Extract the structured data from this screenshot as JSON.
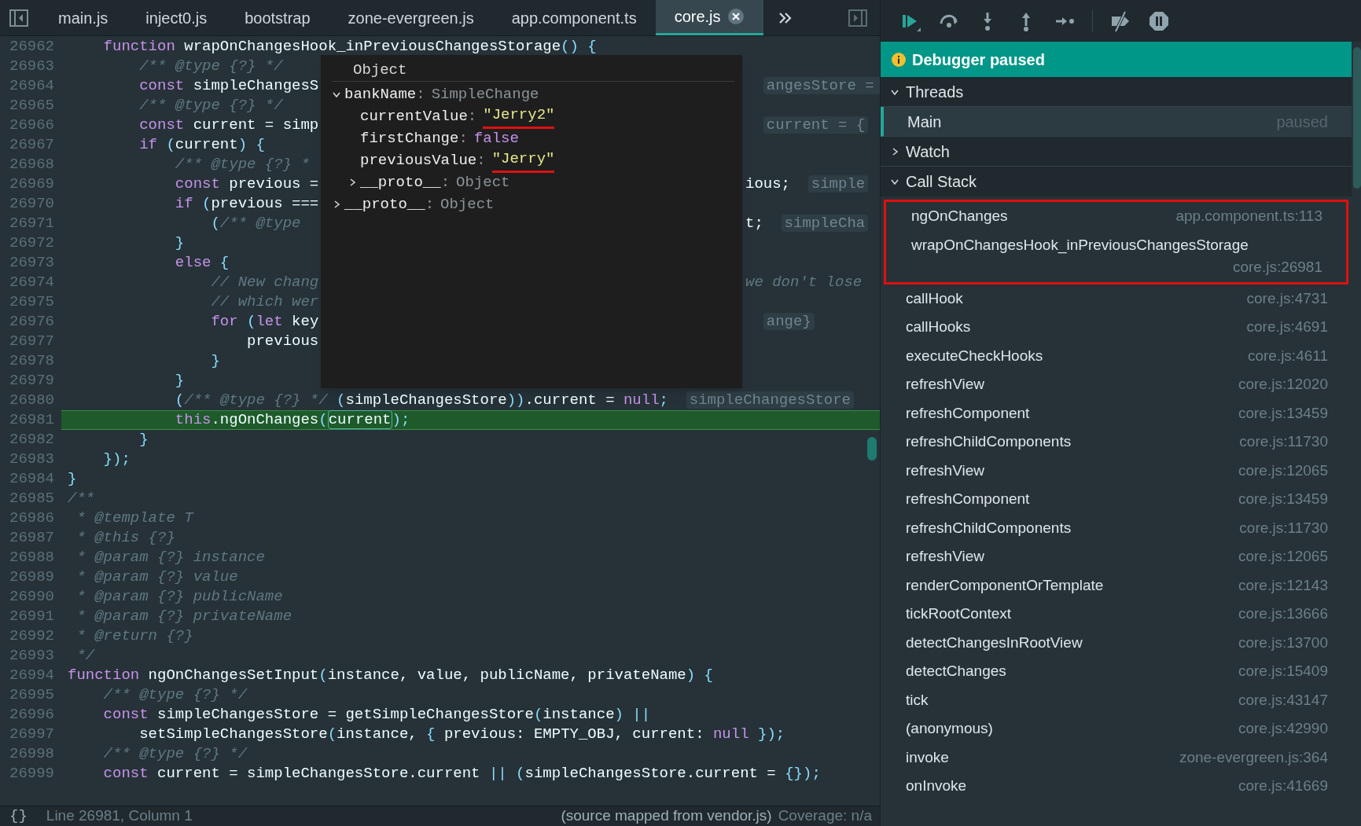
{
  "tabs": [
    {
      "label": "main.js",
      "selected": false
    },
    {
      "label": "inject0.js",
      "selected": false
    },
    {
      "label": "bootstrap",
      "selected": false
    },
    {
      "label": "zone-evergreen.js",
      "selected": false
    },
    {
      "label": "app.component.ts",
      "selected": false
    },
    {
      "label": "core.js",
      "selected": true
    }
  ],
  "editor": {
    "lines": [
      {
        "num": "26962",
        "highlighted": false,
        "code": [
          {
            "t": "    function",
            "kind": "kw"
          },
          {
            "t": " wrapOnChangesHook_inPreviousChangesStorage",
            "kind": "id"
          },
          {
            "t": "() {",
            "kind": "pn"
          }
        ]
      },
      {
        "num": "26963",
        "highlighted": false,
        "code": [
          {
            "t": "        /** @type {?} */",
            "kind": "cm"
          }
        ]
      },
      {
        "num": "26964",
        "highlighted": false,
        "code": [
          {
            "t": "        const",
            "kind": "kw"
          },
          {
            "t": " simpleChangesS",
            "kind": "id"
          }
        ],
        "after": [
          {
            "t": "angesStore = ",
            "kind": "hint"
          }
        ]
      },
      {
        "num": "26965",
        "highlighted": false,
        "code": [
          {
            "t": "        /** @type {?} */",
            "kind": "cm"
          }
        ]
      },
      {
        "num": "26966",
        "highlighted": false,
        "code": [
          {
            "t": "        const",
            "kind": "kw"
          },
          {
            "t": " current = simp",
            "kind": "id"
          }
        ],
        "after": [
          {
            "t": "current = {",
            "kind": "hint"
          }
        ]
      },
      {
        "num": "26967",
        "highlighted": false,
        "code": [
          {
            "t": "        if",
            "kind": "kw"
          },
          {
            "t": " (",
            "kind": "pn"
          },
          {
            "t": "current",
            "kind": "id"
          },
          {
            "t": ") {",
            "kind": "pn"
          }
        ]
      },
      {
        "num": "26968",
        "highlighted": false,
        "code": [
          {
            "t": "            /** @type {?} *",
            "kind": "cm"
          }
        ]
      },
      {
        "num": "26969",
        "highlighted": false,
        "code": [
          {
            "t": "            const",
            "kind": "kw"
          },
          {
            "t": " previous =",
            "kind": "id"
          }
        ],
        "after": [
          {
            "t": "ious;",
            "kind": "id"
          },
          {
            "t": "simple",
            "kind": "hint"
          }
        ]
      },
      {
        "num": "26970",
        "highlighted": false,
        "code": [
          {
            "t": "            if",
            "kind": "kw"
          },
          {
            "t": " (",
            "kind": "pn"
          },
          {
            "t": "previous ===",
            "kind": "id"
          }
        ]
      },
      {
        "num": "26971",
        "highlighted": false,
        "code": [
          {
            "t": "                (",
            "kind": "pn"
          },
          {
            "t": "/** @type",
            "kind": "cm"
          }
        ],
        "after": [
          {
            "t": "t;",
            "kind": "id"
          },
          {
            "t": "simpleCha",
            "kind": "hint"
          }
        ]
      },
      {
        "num": "26972",
        "highlighted": false,
        "code": [
          {
            "t": "            }",
            "kind": "pn"
          }
        ]
      },
      {
        "num": "26973",
        "highlighted": false,
        "code": [
          {
            "t": "            else",
            "kind": "kw"
          },
          {
            "t": " {",
            "kind": "pn"
          }
        ]
      },
      {
        "num": "26974",
        "highlighted": false,
        "code": [
          {
            "t": "                // New chang",
            "kind": "cm"
          }
        ],
        "after": [
          {
            "t": "we don't lose",
            "kind": "cm"
          }
        ]
      },
      {
        "num": "26975",
        "highlighted": false,
        "code": [
          {
            "t": "                // which wer",
            "kind": "cm"
          }
        ]
      },
      {
        "num": "26976",
        "highlighted": false,
        "code": [
          {
            "t": "                for",
            "kind": "kw"
          },
          {
            "t": " (",
            "kind": "pn"
          },
          {
            "t": "let",
            "kind": "kw"
          },
          {
            "t": " key",
            "kind": "id"
          }
        ],
        "after": [
          {
            "t": "ange}",
            "kind": "hint"
          }
        ]
      },
      {
        "num": "26977",
        "highlighted": false,
        "code": [
          {
            "t": "                    previous",
            "kind": "id"
          }
        ]
      },
      {
        "num": "26978",
        "highlighted": false,
        "code": [
          {
            "t": "                }",
            "kind": "pn"
          }
        ]
      },
      {
        "num": "26979",
        "highlighted": false,
        "code": [
          {
            "t": "            }",
            "kind": "pn"
          }
        ]
      },
      {
        "num": "26980",
        "highlighted": false,
        "code": [
          {
            "t": "            (",
            "kind": "pn"
          },
          {
            "t": "/** @type {?} */",
            "kind": "cm"
          },
          {
            "t": " (",
            "kind": "pn"
          },
          {
            "t": "simpleChangesStore",
            "kind": "id"
          },
          {
            "t": "))",
            "kind": "pn"
          },
          {
            "t": ".current = ",
            "kind": "id"
          },
          {
            "t": "null",
            "kind": "kw"
          },
          {
            "t": ";",
            "kind": "pn"
          },
          {
            "t": "simpleChangesStore",
            "kind": "hint"
          }
        ]
      },
      {
        "num": "26981",
        "highlighted": true,
        "code": [
          {
            "t": "            this",
            "kind": "kw"
          },
          {
            "t": ".ngOnChanges",
            "kind": "id"
          },
          {
            "t": "(",
            "kind": "pn"
          },
          {
            "t": "current",
            "kind": "focus"
          },
          {
            "t": ");",
            "kind": "pn"
          }
        ]
      },
      {
        "num": "26982",
        "highlighted": false,
        "code": [
          {
            "t": "        }",
            "kind": "pn"
          }
        ]
      },
      {
        "num": "26983",
        "highlighted": false,
        "code": [
          {
            "t": "    });",
            "kind": "pn"
          }
        ]
      },
      {
        "num": "26984",
        "highlighted": false,
        "code": [
          {
            "t": "}",
            "kind": "pn"
          }
        ]
      },
      {
        "num": "26985",
        "highlighted": false,
        "code": [
          {
            "t": "/**",
            "kind": "cm"
          }
        ]
      },
      {
        "num": "26986",
        "highlighted": false,
        "code": [
          {
            "t": " * @template T",
            "kind": "cm"
          }
        ]
      },
      {
        "num": "26987",
        "highlighted": false,
        "code": [
          {
            "t": " * @this {?}",
            "kind": "cm"
          }
        ]
      },
      {
        "num": "26988",
        "highlighted": false,
        "code": [
          {
            "t": " * @param {?} instance",
            "kind": "cm"
          }
        ]
      },
      {
        "num": "26989",
        "highlighted": false,
        "code": [
          {
            "t": " * @param {?} value",
            "kind": "cm"
          }
        ]
      },
      {
        "num": "26990",
        "highlighted": false,
        "code": [
          {
            "t": " * @param {?} publicName",
            "kind": "cm"
          }
        ]
      },
      {
        "num": "26991",
        "highlighted": false,
        "code": [
          {
            "t": " * @param {?} privateName",
            "kind": "cm"
          }
        ]
      },
      {
        "num": "26992",
        "highlighted": false,
        "code": [
          {
            "t": " * @return {?}",
            "kind": "cm"
          }
        ]
      },
      {
        "num": "26993",
        "highlighted": false,
        "code": [
          {
            "t": " */",
            "kind": "cm"
          }
        ]
      },
      {
        "num": "26994",
        "highlighted": false,
        "code": [
          {
            "t": "function",
            "kind": "kw"
          },
          {
            "t": " ngOnChangesSetInput",
            "kind": "id"
          },
          {
            "t": "(",
            "kind": "pn"
          },
          {
            "t": "instance, value, publicName, privateName",
            "kind": "id"
          },
          {
            "t": ") {",
            "kind": "pn"
          }
        ]
      },
      {
        "num": "26995",
        "highlighted": false,
        "code": [
          {
            "t": "    /** @type {?} */",
            "kind": "cm"
          }
        ]
      },
      {
        "num": "26996",
        "highlighted": false,
        "code": [
          {
            "t": "    const",
            "kind": "kw"
          },
          {
            "t": " simpleChangesStore = getSimpleChangesStore",
            "kind": "id"
          },
          {
            "t": "(",
            "kind": "pn"
          },
          {
            "t": "instance",
            "kind": "id"
          },
          {
            "t": ") ||",
            "kind": "pn"
          }
        ]
      },
      {
        "num": "26997",
        "highlighted": false,
        "code": [
          {
            "t": "        setSimpleChangesStore",
            "kind": "id"
          },
          {
            "t": "(",
            "kind": "pn"
          },
          {
            "t": "instance, ",
            "kind": "id"
          },
          {
            "t": "{ ",
            "kind": "pn"
          },
          {
            "t": "previous: EMPTY_OBJ, current: ",
            "kind": "id"
          },
          {
            "t": "null",
            "kind": "kw"
          },
          {
            "t": " });",
            "kind": "pn"
          }
        ]
      },
      {
        "num": "26998",
        "highlighted": false,
        "code": [
          {
            "t": "    /** @type {?} */",
            "kind": "cm"
          }
        ]
      },
      {
        "num": "26999",
        "highlighted": false,
        "code": [
          {
            "t": "    const",
            "kind": "kw"
          },
          {
            "t": " current = simpleChangesStore.current ",
            "kind": "id"
          },
          {
            "t": "|| (",
            "kind": "pn"
          },
          {
            "t": "simpleChangesStore.current = ",
            "kind": "id"
          },
          {
            "t": "{});",
            "kind": "pn"
          }
        ]
      }
    ],
    "popover": {
      "title": "Object",
      "tree": [
        {
          "name": "bankName",
          "sep": ":",
          "value": "SimpleChange",
          "kind": "type",
          "expanded": true,
          "children": [
            {
              "name": "currentValue",
              "sep": ":",
              "value": "\"Jerry2\"",
              "kind": "string",
              "underlined": true
            },
            {
              "name": "firstChange",
              "sep": ":",
              "value": "false",
              "kind": "boolean",
              "underlined": false
            },
            {
              "name": "previousValue",
              "sep": ":",
              "value": "\"Jerry\"",
              "kind": "string",
              "underlined": true
            },
            {
              "name": "__proto__",
              "sep": ":",
              "value": "Object",
              "kind": "type",
              "expanded": false
            }
          ]
        },
        {
          "name": "__proto__",
          "sep": ":",
          "value": "Object",
          "kind": "type",
          "expanded": false
        }
      ]
    }
  },
  "status_bar": {
    "format_button": "{}",
    "position": "Line 26981, Column 1",
    "source_map": "(source mapped from vendor.js)",
    "coverage": "Coverage: n/a"
  },
  "debugger": {
    "banner": "Debugger paused",
    "threads": {
      "title": "Threads",
      "expanded": true,
      "items": [
        {
          "name": "Main",
          "status": "paused",
          "selected": true
        }
      ]
    },
    "watch": {
      "title": "Watch",
      "expanded": false
    },
    "call_stack": {
      "title": "Call Stack",
      "expanded": true,
      "frames": [
        {
          "name": "ngOnChanges",
          "location": "app.component.ts:113",
          "annotated": true
        },
        {
          "name": "wrapOnChangesHook_inPreviousChangesStorage",
          "location": "core.js:26981",
          "annotated": true
        },
        {
          "name": "callHook",
          "location": "core.js:4731",
          "annotated": false
        },
        {
          "name": "callHooks",
          "location": "core.js:4691",
          "annotated": false
        },
        {
          "name": "executeCheckHooks",
          "location": "core.js:4611",
          "annotated": false
        },
        {
          "name": "refreshView",
          "location": "core.js:12020",
          "annotated": false
        },
        {
          "name": "refreshComponent",
          "location": "core.js:13459",
          "annotated": false
        },
        {
          "name": "refreshChildComponents",
          "location": "core.js:11730",
          "annotated": false
        },
        {
          "name": "refreshView",
          "location": "core.js:12065",
          "annotated": false
        },
        {
          "name": "refreshComponent",
          "location": "core.js:13459",
          "annotated": false
        },
        {
          "name": "refreshChildComponents",
          "location": "core.js:11730",
          "annotated": false
        },
        {
          "name": "refreshView",
          "location": "core.js:12065",
          "annotated": false
        },
        {
          "name": "renderComponentOrTemplate",
          "location": "core.js:12143",
          "annotated": false
        },
        {
          "name": "tickRootContext",
          "location": "core.js:13666",
          "annotated": false
        },
        {
          "name": "detectChangesInRootView",
          "location": "core.js:13700",
          "annotated": false
        },
        {
          "name": "detectChanges",
          "location": "core.js:15409",
          "annotated": false
        },
        {
          "name": "tick",
          "location": "core.js:43147",
          "annotated": false
        },
        {
          "name": "(anonymous)",
          "location": "core.js:42990",
          "annotated": false
        },
        {
          "name": "invoke",
          "location": "zone-evergreen.js:364",
          "annotated": false
        },
        {
          "name": "onInvoke",
          "location": "core.js:41669",
          "annotated": false
        }
      ]
    }
  }
}
